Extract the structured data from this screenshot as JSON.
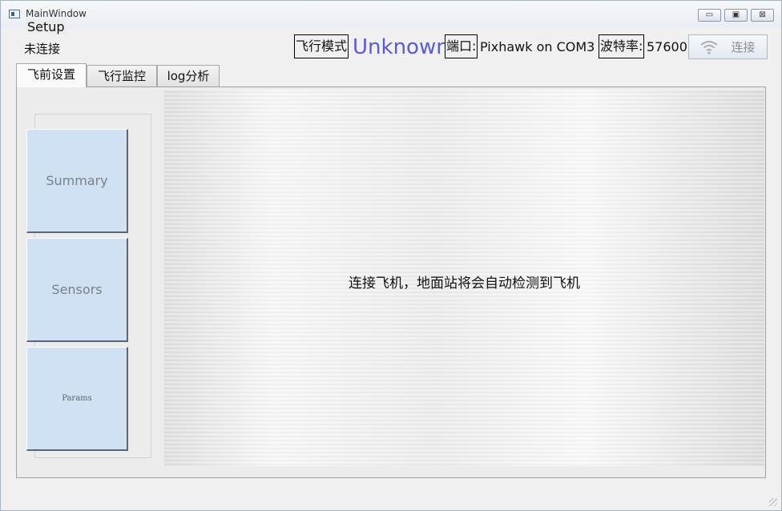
{
  "window": {
    "title": "MainWindow",
    "controls": {
      "minimize": "▭",
      "maximize": "▣",
      "close": "⊠"
    }
  },
  "toolbar": {
    "connection_status": "未连接",
    "flight_mode_label": "飞行模式",
    "flight_mode_value": "Unknown",
    "port_label": "端口:",
    "port_value": "Pixhawk on COM3",
    "baud_label": "波特率:",
    "baud_value": "57600",
    "connect_button": {
      "label": "连接",
      "icon": "wifi-icon"
    }
  },
  "tabs": [
    {
      "label": "飞前设置",
      "active": true
    },
    {
      "label": "飞行监控",
      "active": false
    },
    {
      "label": "log分析",
      "active": false
    }
  ],
  "setup": {
    "title": "Setup",
    "buttons": [
      {
        "label": "Summary"
      },
      {
        "label": "Sensors"
      },
      {
        "label": "Params"
      }
    ]
  },
  "main": {
    "message": "连接飞机，地面站将会自动检测到飞机"
  },
  "colors": {
    "mode_value": "#5b5bd8",
    "side_button_bg": "#cfe1f3"
  }
}
